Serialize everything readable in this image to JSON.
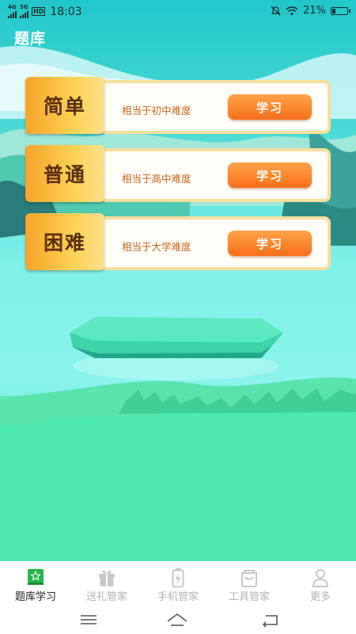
{
  "status_bar": {
    "network_1": "4G",
    "network_2": "5G",
    "hd": "HD",
    "time": "18:03",
    "battery": "21%",
    "battery_level": 0.21,
    "icons": [
      "signal-icon",
      "signal-icon",
      "hd-icon",
      "mute-icon",
      "wifi-icon",
      "battery-icon"
    ]
  },
  "header": {
    "title": "题库"
  },
  "levels": [
    {
      "name": "简单",
      "description": "相当于初中难度",
      "button": "学习"
    },
    {
      "name": "普通",
      "description": "相当于高中难度",
      "button": "学习"
    },
    {
      "name": "困难",
      "description": "相当于大学难度",
      "button": "学习"
    }
  ],
  "tabs": [
    {
      "label": "题库学习",
      "icon": "star-badge-icon",
      "active": true
    },
    {
      "label": "送礼管家",
      "icon": "gift-icon",
      "active": false
    },
    {
      "label": "手机管家",
      "icon": "battery-bolt-icon",
      "active": false
    },
    {
      "label": "工具管家",
      "icon": "bag-icon",
      "active": false
    },
    {
      "label": "更多",
      "icon": "person-icon",
      "active": false
    }
  ],
  "nav_bar": {
    "icons": [
      "menu-icon",
      "home-icon",
      "back-icon"
    ]
  },
  "colors": {
    "accent_green": "#27b54a",
    "button_orange": "#f77f22",
    "description_text": "#c4661c",
    "tab_inactive": "#b4b4b4"
  }
}
